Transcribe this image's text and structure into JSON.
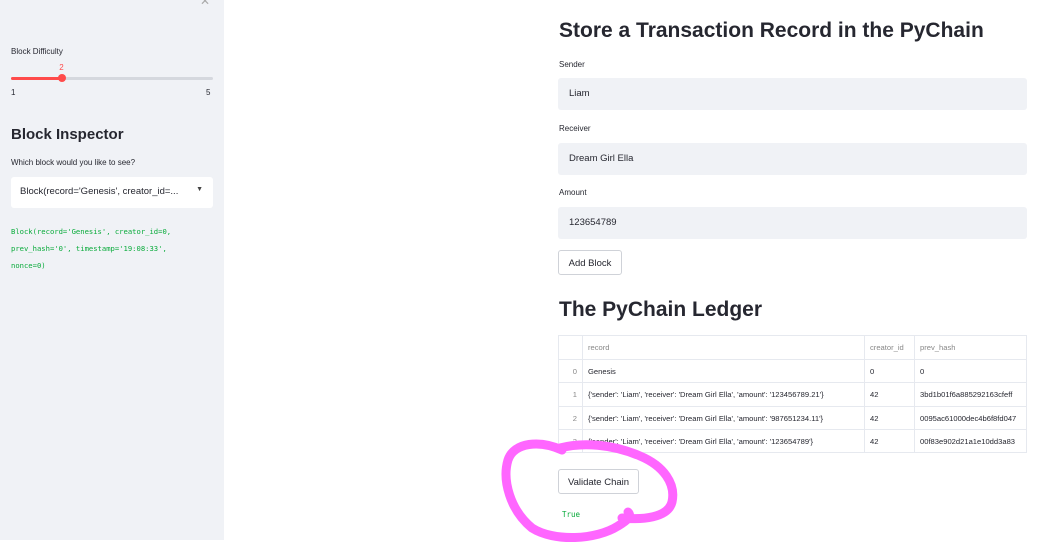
{
  "sidebar": {
    "slider": {
      "label": "Block Difficulty",
      "value": "2",
      "min": "1",
      "max": "5",
      "fraction": 0.25
    },
    "inspector_title": "Block Inspector",
    "select_label": "Which block would you like to see?",
    "select_value": "Block(record='Genesis', creator_id=...",
    "block_code": "Block(record='Genesis', creator_id=0,\nprev_hash='0', timestamp='19:08:33',\nnonce=0)"
  },
  "main": {
    "title": "Store a Transaction Record in the PyChain",
    "fields": [
      {
        "label": "Sender",
        "value": "Liam"
      },
      {
        "label": "Receiver",
        "value": "Dream Girl Ella"
      },
      {
        "label": "Amount",
        "value": "123654789"
      }
    ],
    "add_block_label": "Add Block",
    "ledger_title": "The PyChain Ledger",
    "table": {
      "columns": [
        "",
        "record",
        "creator_id",
        "prev_hash"
      ],
      "rows": [
        [
          "0",
          "Genesis",
          "0",
          "0"
        ],
        [
          "1",
          "{'sender': 'Liam', 'receiver': 'Dream Girl Ella', 'amount': '123456789.21'}",
          "42",
          "3bd1b01f6a885292163cfeff"
        ],
        [
          "2",
          "{'sender': 'Liam', 'receiver': 'Dream Girl Ella', 'amount': '987651234.11'}",
          "42",
          "0095ac61000dec4b6f8fd047"
        ],
        [
          "3",
          "{'sender': 'Liam', 'receiver': 'Dream Girl Ella', 'amount': '123654789'}",
          "42",
          "00f83e902d21a1e10dd3a83"
        ]
      ]
    },
    "validate_label": "Validate Chain",
    "validate_result": "True"
  },
  "colors": {
    "accent": "#ff4b4b",
    "sidebar_bg": "#f0f2f6",
    "code_green": "#09ab3b",
    "highlight": "#ff66ff"
  }
}
